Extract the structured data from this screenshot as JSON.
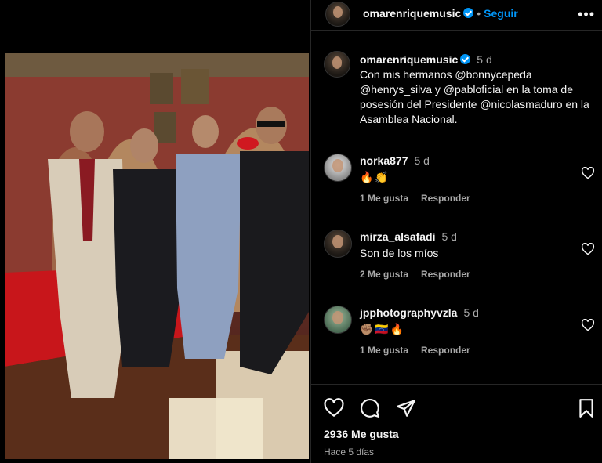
{
  "post": {
    "username": "omarenriquemusic",
    "follow_label": "Seguir",
    "more_label": "•••",
    "caption": {
      "username": "omarenriquemusic",
      "time": "5 d",
      "text": "Con mis hermanos @bonnycepeda @henrys_silva y @pabloficial en la toma de posesión del Presidente @nicolasmaduro en la Asamblea Nacional."
    },
    "likes_text": "2936 Me gusta",
    "posted_ago": "Hace 5 días"
  },
  "comments": [
    {
      "username": "norka877",
      "time": "5 d",
      "text": "🔥👏",
      "likes": "1 Me gusta",
      "reply": "Responder"
    },
    {
      "username": "mirza_alsafadi",
      "time": "5 d",
      "text": "Son de los míos",
      "likes": "2 Me gusta",
      "reply": "Responder"
    },
    {
      "username": "jpphotographyvzla",
      "time": "5 d",
      "text": "✊🏽🇻🇪🔥",
      "likes": "1 Me gusta",
      "reply": "Responder"
    }
  ],
  "icons": {
    "like": "heart-icon",
    "comment": "comment-icon",
    "share": "share-icon",
    "save": "bookmark-icon"
  },
  "colors": {
    "accent": "#0095f6",
    "background": "#000000",
    "muted": "#a8a8a8"
  }
}
